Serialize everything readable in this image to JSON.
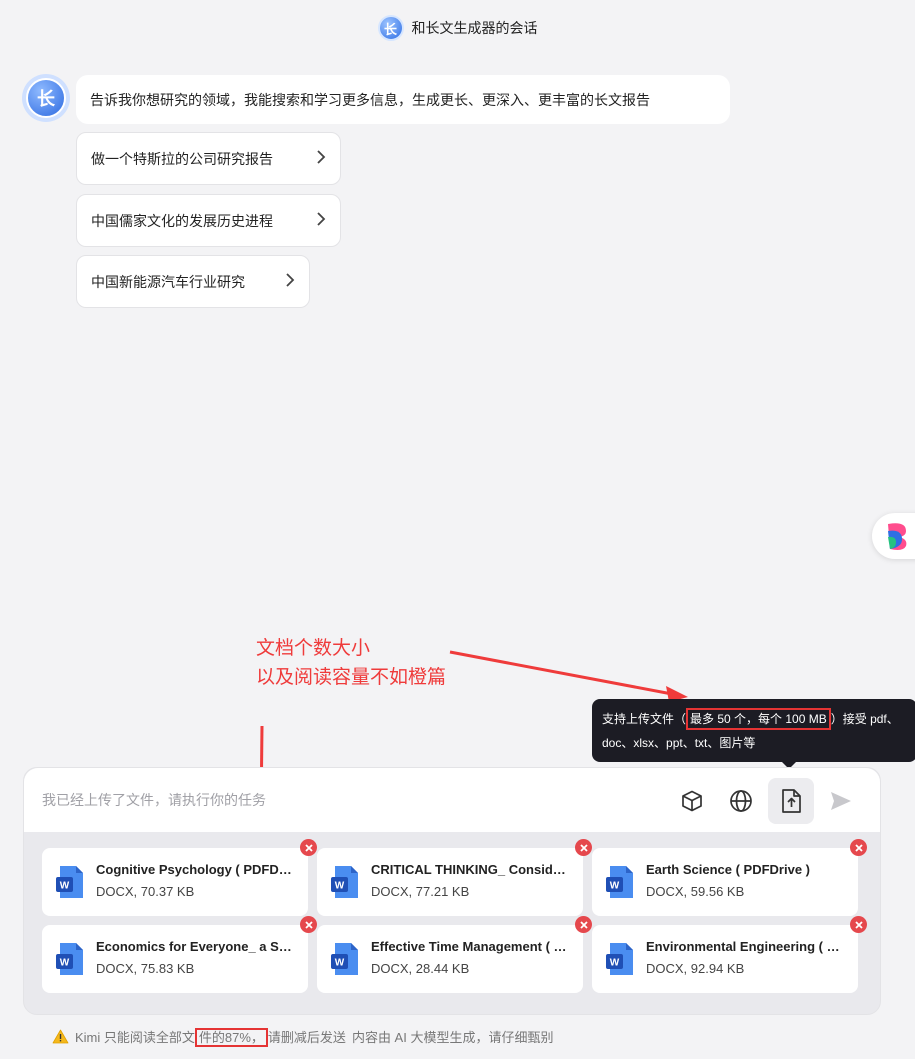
{
  "header": {
    "logo_char": "长",
    "title": "和长文生成器的会话"
  },
  "chat": {
    "avatar_char": "长",
    "message": "告诉我你想研究的领域，我能搜索和学习更多信息，生成更长、更深入、更丰富的长文报告",
    "suggestions": [
      {
        "label": "做一个特斯拉的公司研究报告"
      },
      {
        "label": "中国儒家文化的发展历史进程"
      },
      {
        "label": "中国新能源汽车行业研究"
      }
    ]
  },
  "annotation": {
    "line1": "文档个数大小",
    "line2": "以及阅读容量不如橙篇",
    "color": "#ef3b3b"
  },
  "tooltip": {
    "prefix": "支持上传文件（",
    "highlight": "最多 50 个，每个 100 MB",
    "suffix": "）接受 pdf、",
    "line2": "doc、xlsx、ppt、txt、图片等"
  },
  "composer": {
    "placeholder": "我已经上传了文件，请执行你的任务",
    "tools": [
      "cube-icon",
      "globe-icon",
      "upload-file-icon",
      "send-icon"
    ]
  },
  "files": [
    {
      "name": "Cognitive Psychology ( PDFDrive )",
      "size": "DOCX, 70.37 KB"
    },
    {
      "name": "CRITICAL THINKING_ Consider the Verdict",
      "size": "DOCX, 77.21 KB"
    },
    {
      "name": "Earth Science ( PDFDrive )",
      "size": "DOCX, 59.56 KB"
    },
    {
      "name": "Economics for Everyone_ a Short Guide",
      "size": "DOCX, 75.83 KB"
    },
    {
      "name": "Effective Time Management ( PDFDrive )",
      "size": "DOCX, 28.44 KB"
    },
    {
      "name": "Environmental Engineering ( PDFDrive )",
      "size": "DOCX, 92.94 KB"
    }
  ],
  "footer": {
    "prefix": "Kimi 只能阅读全部文",
    "highlight": "件的87%，",
    "suffix": "请删减后发送",
    "note": "内容由 AI 大模型生成，请仔细甄别"
  },
  "colors": {
    "accent": "#2f6fe4",
    "danger": "#e5484d",
    "word_blue": "#2b5bd7"
  }
}
